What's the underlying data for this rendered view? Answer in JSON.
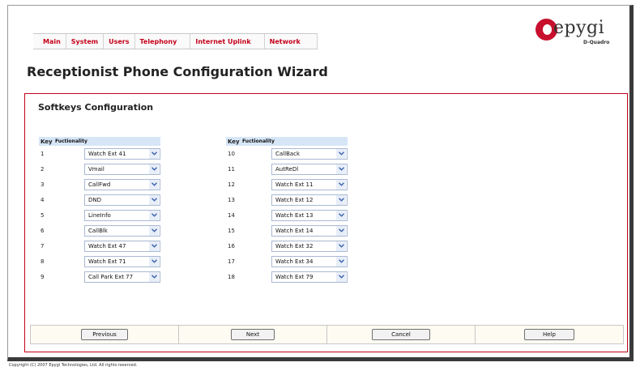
{
  "nav": {
    "items": [
      "Main",
      "System",
      "Users",
      "Telephony",
      "Internet Uplink",
      "Network"
    ]
  },
  "logo": {
    "text": "epygi",
    "subtitle": "D-Quadro"
  },
  "page": {
    "title": "Receptionist Phone Configuration Wizard"
  },
  "panel": {
    "title": "Softkeys Configuration",
    "col_key": "Key",
    "col_func": "Fuctionality",
    "left_rows": [
      {
        "key": "1",
        "value": "Watch Ext 41"
      },
      {
        "key": "2",
        "value": "Vmail"
      },
      {
        "key": "3",
        "value": "CallFwd"
      },
      {
        "key": "4",
        "value": "DND"
      },
      {
        "key": "5",
        "value": "LineInfo"
      },
      {
        "key": "6",
        "value": "CallBlk"
      },
      {
        "key": "7",
        "value": "Watch Ext 47"
      },
      {
        "key": "8",
        "value": "Watch Ext 71"
      },
      {
        "key": "9",
        "value": "Call Park Ext 77"
      }
    ],
    "right_rows": [
      {
        "key": "10",
        "value": "CallBack"
      },
      {
        "key": "11",
        "value": "AutReDl"
      },
      {
        "key": "12",
        "value": "Watch Ext 11"
      },
      {
        "key": "13",
        "value": "Watch Ext 12"
      },
      {
        "key": "14",
        "value": "Watch Ext 13"
      },
      {
        "key": "15",
        "value": "Watch Ext 14"
      },
      {
        "key": "16",
        "value": "Watch Ext 32"
      },
      {
        "key": "17",
        "value": "Watch Ext 34"
      },
      {
        "key": "18",
        "value": "Watch Ext 79"
      }
    ]
  },
  "buttons": {
    "previous": "Previous",
    "next": "Next",
    "cancel": "Cancel",
    "help": "Help"
  },
  "footer": {
    "copyright": "Copyright (C) 2007 Epygi Technologies, Ltd. All rights reserved."
  },
  "colors": {
    "nav_text": "#c4001a",
    "panel_border": "#c4001a",
    "table_header": "#d6e6f7",
    "button_bar": "#fdfbf2"
  },
  "icons": {
    "select_arrow": "chevron-down-icon",
    "logo": "epygi-logo-icon"
  }
}
